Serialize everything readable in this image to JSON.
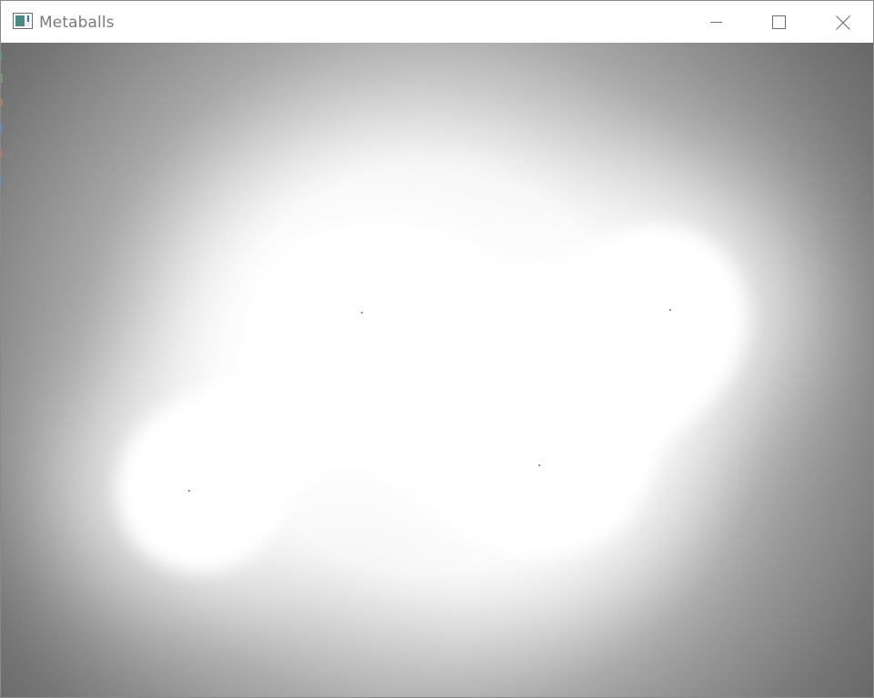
{
  "window": {
    "title": "Metaballs",
    "controls": {
      "minimize": "minimize-icon",
      "maximize": "maximize-icon",
      "close": "close-icon"
    }
  },
  "scene": {
    "type": "metaballs",
    "background_gray": "#6a6a6a",
    "ball_color": "#ffffff",
    "ball_count": 4
  }
}
